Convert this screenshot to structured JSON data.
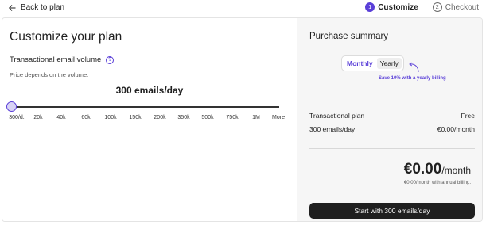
{
  "topbar": {
    "back_label": "Back to plan",
    "steps": [
      {
        "number": "1",
        "label": "Customize",
        "state": "active"
      },
      {
        "number": "2",
        "label": "Checkout",
        "state": "inactive"
      }
    ]
  },
  "plan": {
    "title": "Customize your plan",
    "volume_label": "Transactional email volume",
    "help_icon": "?",
    "price_note": "Price depends on the volume.",
    "current_value": "300 emails/day",
    "slider_position": 0,
    "ticks": [
      "300/d.",
      "20k",
      "40k",
      "60k",
      "100k",
      "150k",
      "200k",
      "350k",
      "500k",
      "750k",
      "1M",
      "More"
    ]
  },
  "summary": {
    "title": "Purchase summary",
    "toggle": {
      "monthly": "Monthly",
      "yearly": "Yearly",
      "selected": "Monthly"
    },
    "promo": "Save 10% with a yearly billing",
    "line_items": [
      {
        "label": "Transactional plan",
        "value": "Free"
      },
      {
        "label": "300 emails/day",
        "value": "€0.00/month"
      }
    ],
    "total_amount": "€0.00",
    "total_period": "/month",
    "total_note": "€0.00/month with annual billing.",
    "cta_label": "Start with 300 emails/day"
  },
  "colors": {
    "accent": "#5a3fd8",
    "cta_bg": "#1f1f1f",
    "panel_bg": "#f6f6f6"
  },
  "icons": {
    "back": "arrow-left-icon",
    "help": "question-circle-icon",
    "promo_arrow": "curved-arrow-icon"
  }
}
